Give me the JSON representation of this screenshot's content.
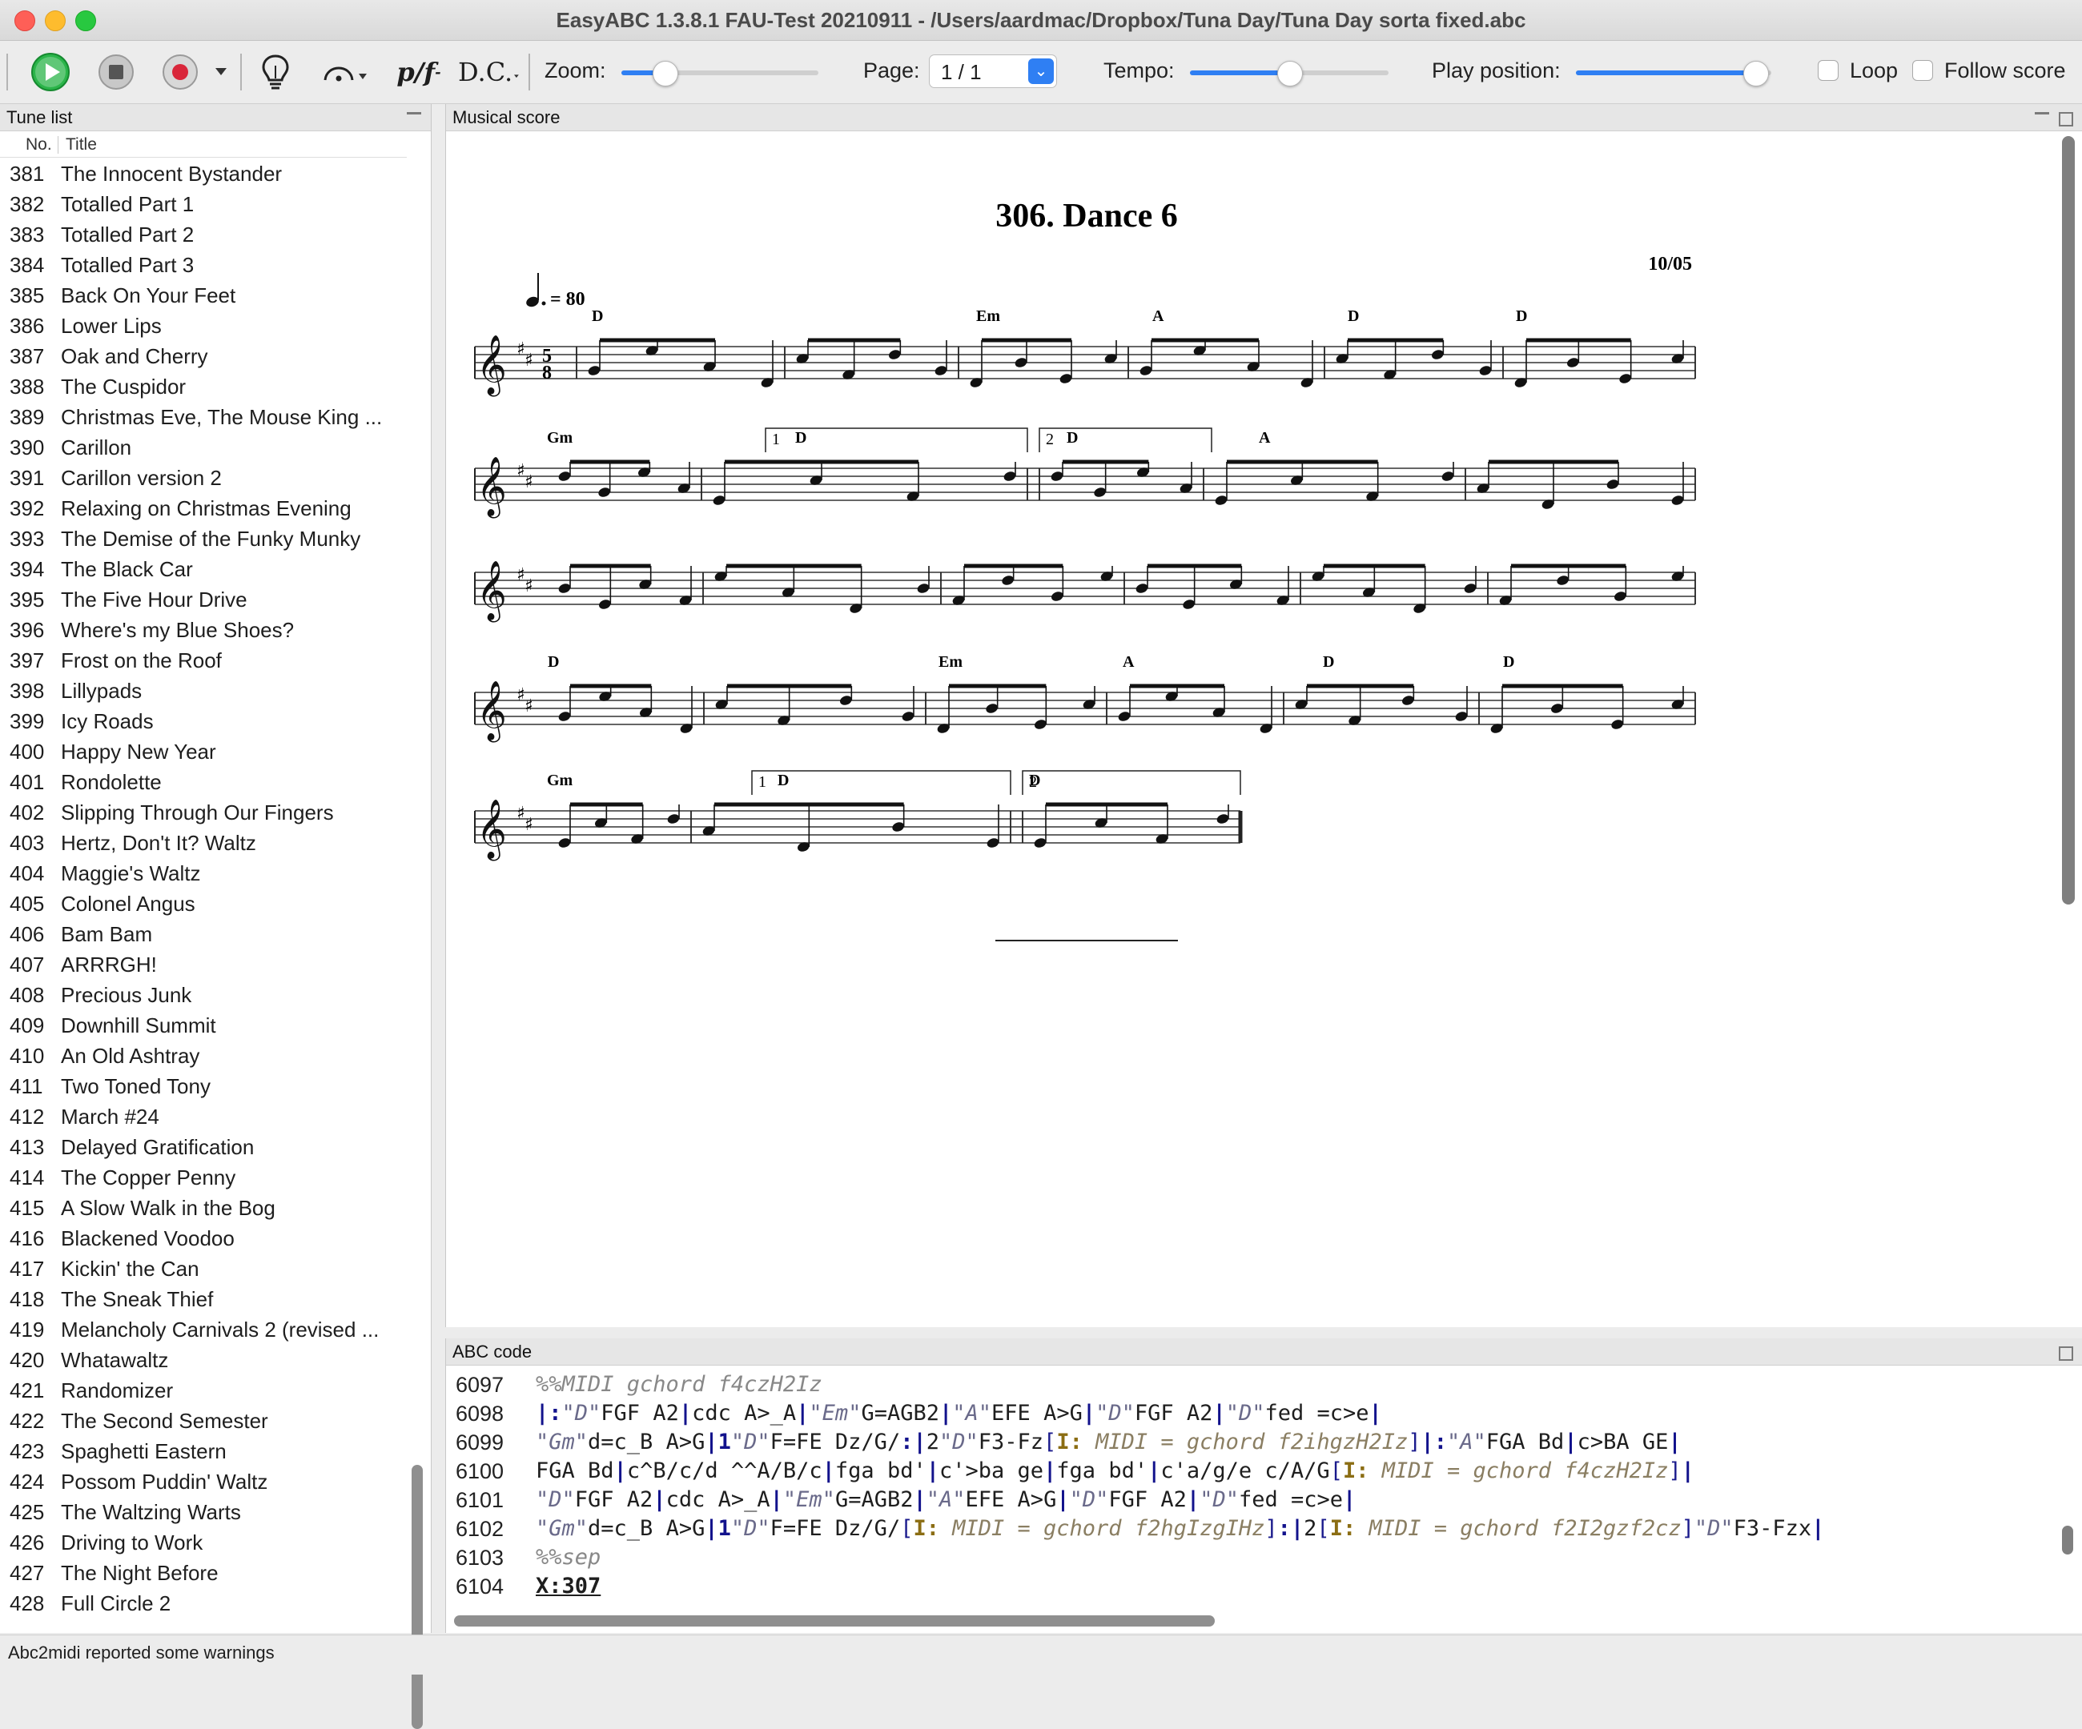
{
  "window": {
    "title": "EasyABC 1.3.8.1 FAU-Test 20210911 - /Users/aardmac/Dropbox/Tuna Day/Tuna Day sorta fixed.abc"
  },
  "toolbar": {
    "play_icon": "play-icon",
    "stop_icon": "stop-icon",
    "record_icon": "record-icon",
    "hint_icon": "lightbulb-icon",
    "fermata_icon": "fermata-icon",
    "dynamics_label": "p/f",
    "dc_label": "D.C.",
    "zoom_label": "Zoom:",
    "zoom_level": 0.22,
    "page_label": "Page:",
    "page_value": "1 / 1",
    "tempo_label": "Tempo:",
    "tempo_level": 0.5,
    "play_position_label": "Play position:",
    "play_position_level": 0.92,
    "loop_label": "Loop",
    "follow_label": "Follow score"
  },
  "tune_list": {
    "header": "Tune list",
    "col_no": "No.",
    "col_title": "Title",
    "rows": [
      {
        "no": "381",
        "title": "The Innocent Bystander"
      },
      {
        "no": "382",
        "title": "Totalled Part 1"
      },
      {
        "no": "383",
        "title": "Totalled Part 2"
      },
      {
        "no": "384",
        "title": "Totalled Part 3"
      },
      {
        "no": "385",
        "title": "Back On Your Feet"
      },
      {
        "no": "386",
        "title": "Lower Lips"
      },
      {
        "no": "387",
        "title": "Oak and Cherry"
      },
      {
        "no": "388",
        "title": "The Cuspidor"
      },
      {
        "no": "389",
        "title": "Christmas Eve, The Mouse King ..."
      },
      {
        "no": "390",
        "title": "Carillon"
      },
      {
        "no": "391",
        "title": "Carillon version 2"
      },
      {
        "no": "392",
        "title": "Relaxing on Christmas Evening"
      },
      {
        "no": "393",
        "title": "The Demise of the Funky Munky"
      },
      {
        "no": "394",
        "title": "The Black Car"
      },
      {
        "no": "395",
        "title": "The Five Hour Drive"
      },
      {
        "no": "396",
        "title": "Where's my Blue Shoes?"
      },
      {
        "no": "397",
        "title": "Frost on the Roof"
      },
      {
        "no": "398",
        "title": "Lillypads"
      },
      {
        "no": "399",
        "title": "Icy Roads"
      },
      {
        "no": "400",
        "title": "Happy New Year"
      },
      {
        "no": "401",
        "title": "Rondolette"
      },
      {
        "no": "402",
        "title": "Slipping Through Our Fingers"
      },
      {
        "no": "403",
        "title": "Hertz, Don't It? Waltz"
      },
      {
        "no": "404",
        "title": "Maggie's Waltz"
      },
      {
        "no": "405",
        "title": "Colonel Angus"
      },
      {
        "no": "406",
        "title": "Bam Bam"
      },
      {
        "no": "407",
        "title": "ARRRGH!"
      },
      {
        "no": "408",
        "title": "Precious Junk"
      },
      {
        "no": "409",
        "title": "Downhill Summit"
      },
      {
        "no": "410",
        "title": "An Old Ashtray"
      },
      {
        "no": "411",
        "title": "Two Toned Tony"
      },
      {
        "no": "412",
        "title": "March #24"
      },
      {
        "no": "413",
        "title": "Delayed Gratification"
      },
      {
        "no": "414",
        "title": "The Copper Penny"
      },
      {
        "no": "415",
        "title": "A Slow Walk in the Bog"
      },
      {
        "no": "416",
        "title": "Blackened Voodoo"
      },
      {
        "no": "417",
        "title": "Kickin' the Can"
      },
      {
        "no": "418",
        "title": "The Sneak Thief"
      },
      {
        "no": "419",
        "title": "Melancholy Carnivals 2 (revised ..."
      },
      {
        "no": "420",
        "title": "Whatawaltz"
      },
      {
        "no": "421",
        "title": "Randomizer"
      },
      {
        "no": "422",
        "title": "The Second Semester"
      },
      {
        "no": "423",
        "title": "Spaghetti Eastern"
      },
      {
        "no": "424",
        "title": "Possom Puddin' Waltz"
      },
      {
        "no": "425",
        "title": "The Waltzing Warts"
      },
      {
        "no": "426",
        "title": "Driving to Work"
      },
      {
        "no": "427",
        "title": "The Night Before"
      },
      {
        "no": "428",
        "title": "Full Circle 2"
      }
    ]
  },
  "score": {
    "header": "Musical score",
    "title": "306.  Dance 6",
    "date": "10/05",
    "tempo_mark": "= 80",
    "time_sig_top": "5",
    "time_sig_bottom": "8",
    "chords_row1": [
      "D",
      "Em",
      "A",
      "D",
      "D"
    ],
    "chords_row2": [
      "Gm",
      "D",
      "D",
      "A"
    ],
    "chords_row4": [
      "D",
      "Em",
      "A",
      "D",
      "D"
    ],
    "chords_row5": [
      "Gm",
      "D",
      "D"
    ],
    "ending1": "1",
    "ending2": "2"
  },
  "abc": {
    "header": "ABC code",
    "lines": [
      {
        "no": "6097",
        "text": "%%MIDI gchord f4czH2Iz",
        "kind": "comment"
      },
      {
        "no": "6098",
        "text": "|:\"D\"FGF A2|cdc A>_A|\"Em\"G=AGB2|\"A\"EFE A>G|\"D\"FGF A2|\"D\"fed =c>e|",
        "kind": "code"
      },
      {
        "no": "6099",
        "text": "\"Gm\"d=c_B A>G|1\"D\"F=FE Dz/G/:|2\"D\"F3-Fz[I: MIDI = gchord f2ihgzH2Iz]|:\"A\"FGA Bd|c>BA GE|",
        "kind": "code"
      },
      {
        "no": "6100",
        "text": "FGA Bd|c^B/c/d ^^A/B/c|fga bd'|c'>ba ge|fga bd'|c'a/g/e c/A/G[I: MIDI = gchord f4czH2Iz]|",
        "kind": "code"
      },
      {
        "no": "6101",
        "text": "\"D\"FGF A2|cdc A>_A|\"Em\"G=AGB2|\"A\"EFE A>G|\"D\"FGF A2|\"D\"fed =c>e|",
        "kind": "code"
      },
      {
        "no": "6102",
        "text": "\"Gm\"d=c_B A>G|1\"D\"F=FE Dz/G/[I: MIDI = gchord f2hgIzgIHz]:|2[I: MIDI = gchord f2I2gzf2cz]\"D\"F3-Fzx|",
        "kind": "code"
      },
      {
        "no": "6103",
        "text": "%%sep",
        "kind": "comment"
      },
      {
        "no": "6104",
        "text": "X:307",
        "kind": "header"
      }
    ]
  },
  "status": {
    "text": "Abc2midi reported some warnings"
  }
}
